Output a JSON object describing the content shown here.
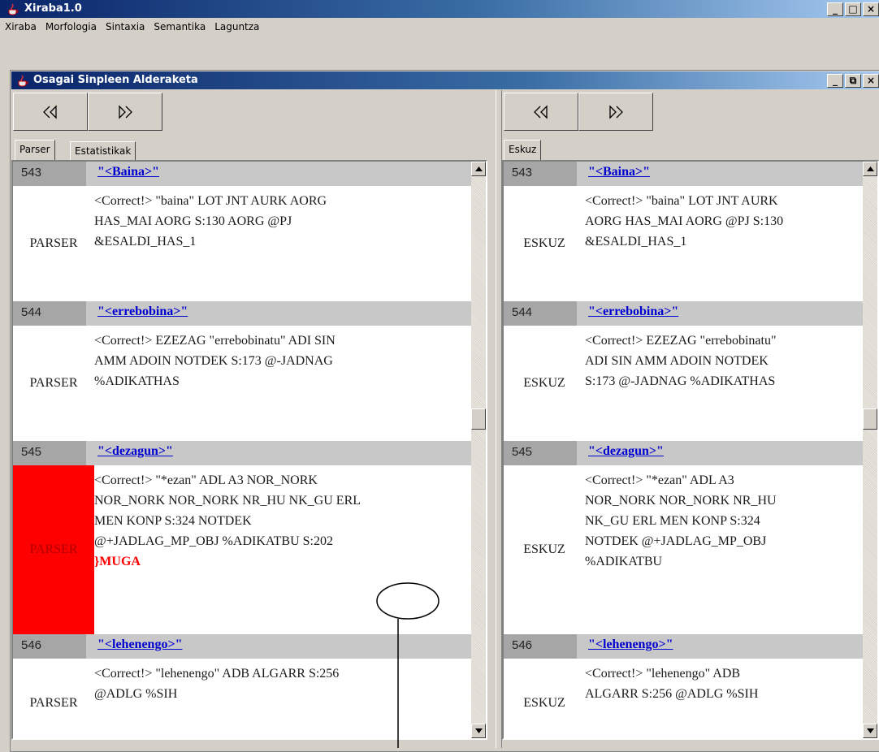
{
  "window": {
    "title": "Xiraba1.0",
    "buttons": [
      "_",
      "□",
      "×"
    ]
  },
  "menu": [
    "Xiraba",
    "Morfologia",
    "Sintaxia",
    "Semantika",
    "Laguntza"
  ],
  "internal_frame": {
    "title": "Osagai Sinpleen Alderaketa",
    "buttons": [
      "_",
      "⧉",
      "×"
    ]
  },
  "left": {
    "nav": {
      "prev": "rewind-icon",
      "next": "fast-forward-icon"
    },
    "tabs": [
      "Parser",
      "Estatistikak"
    ],
    "active_tab": "Parser",
    "entries": [
      {
        "num": "543",
        "word": "\"<Baina>\"",
        "role": "PARSER",
        "error": false,
        "lines": [
          "<Correct!> \"baina\" LOT JNT AURK AORG",
          "HAS_MAI AORG S:130 AORG @PJ",
          "&ESALDI_HAS_1"
        ]
      },
      {
        "num": "544",
        "word": "\"<errebobina>\"",
        "role": "PARSER",
        "error": false,
        "lines": [
          "<Correct!> EZEZAG \"errebobinatu\" ADI SIN",
          "AMM ADOIN NOTDEK S:173 @-JADNAG",
          "%ADIKATHAS"
        ]
      },
      {
        "num": "545",
        "word": "\"<dezagun>\"",
        "role": "PARSER",
        "error": true,
        "lines": [
          "<Correct!> \"*ezan\" ADL A3 NOR_NORK",
          "NOR_NORK NOR_NORK NR_HU NK_GU ERL",
          "MEN KONP S:324 NOTDEK",
          "@+JADLAG_MP_OBJ %ADIKATBU S:202"
        ],
        "extra": "}MUGA"
      },
      {
        "num": "546",
        "word": "\"<lehenengo>\"",
        "role": "PARSER",
        "error": false,
        "lines": [
          "<Correct!> \"lehenengo\" ADB ALGARR S:256",
          "@ADLG %SIH"
        ]
      }
    ]
  },
  "right": {
    "nav": {
      "prev": "rewind-icon",
      "next": "fast-forward-icon"
    },
    "tabs": [
      "Eskuz"
    ],
    "active_tab": "Eskuz",
    "entries": [
      {
        "num": "543",
        "word": "\"<Baina>\"",
        "role": "ESKUZ",
        "error": false,
        "lines": [
          "<Correct!> \"baina\" LOT JNT AURK",
          "AORG HAS_MAI AORG @PJ S:130",
          "&ESALDI_HAS_1"
        ]
      },
      {
        "num": "544",
        "word": "\"<errebobina>\"",
        "role": "ESKUZ",
        "error": false,
        "lines": [
          "<Correct!> EZEZAG \"errebobinatu\"",
          "ADI SIN AMM ADOIN NOTDEK",
          "S:173 @-JADNAG %ADIKATHAS"
        ]
      },
      {
        "num": "545",
        "word": "\"<dezagun>\"",
        "role": "ESKUZ",
        "error": false,
        "lines": [
          "<Correct!> \"*ezan\" ADL A3",
          "NOR_NORK NOR_NORK NR_HU",
          "NK_GU ERL MEN KONP S:324",
          "NOTDEK @+JADLAG_MP_OBJ",
          "%ADIKATBU"
        ]
      },
      {
        "num": "546",
        "word": "\"<lehenengo>\"",
        "role": "ESKUZ",
        "error": false,
        "lines": [
          "<Correct!> \"lehenengo\" ADB",
          "ALGARR S:256 @ADLG %SIH"
        ]
      }
    ]
  }
}
